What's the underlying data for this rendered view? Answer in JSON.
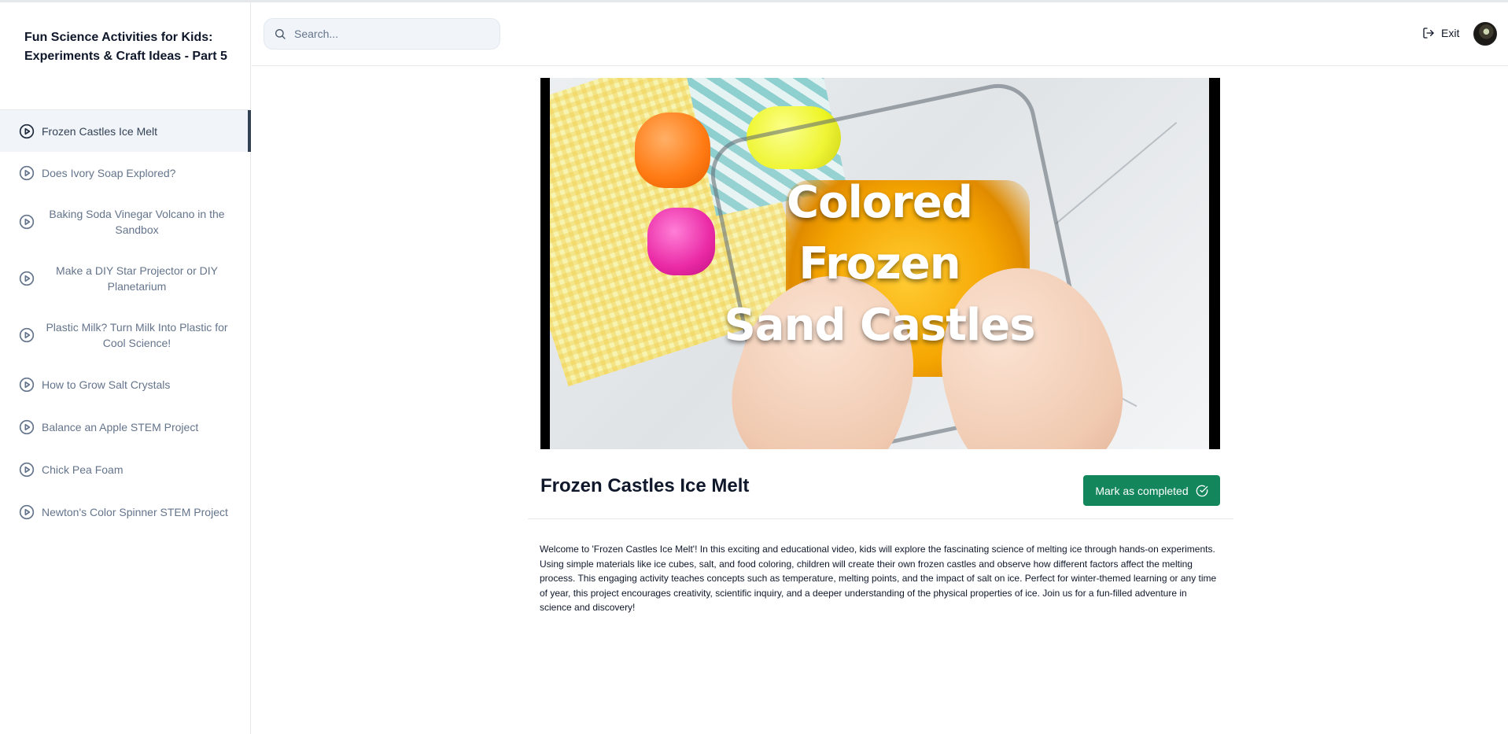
{
  "sidebar": {
    "course_title": "Fun Science Activities for Kids: Experiments & Craft Ideas - Part 5",
    "lessons": [
      {
        "label": "Frozen Castles Ice Melt",
        "active": true
      },
      {
        "label": "Does Ivory Soap Explored?"
      },
      {
        "label": "Baking Soda Vinegar Volcano in the Sandbox"
      },
      {
        "label": "Make a DIY Star Projector or DIY Planetarium"
      },
      {
        "label": "Plastic Milk? Turn Milk Into Plastic for Cool Science!"
      },
      {
        "label": "How to Grow Salt Crystals"
      },
      {
        "label": "Balance an Apple STEM Project"
      },
      {
        "label": "Chick Pea Foam"
      },
      {
        "label": "Newton's Color Spinner STEM Project"
      }
    ]
  },
  "header": {
    "search_placeholder": "Search...",
    "exit_label": "Exit"
  },
  "video": {
    "overlay_line1": "Colored",
    "overlay_line2": "Frozen",
    "overlay_line3": "Sand Castles"
  },
  "lesson": {
    "title": "Frozen Castles Ice Melt",
    "complete_button": "Mark as completed",
    "description": "Welcome to 'Frozen Castles Ice Melt'! In this exciting and educational video, kids will explore the fascinating science of melting ice through hands-on experiments. Using simple materials like ice cubes, salt, and food coloring, children will create their own frozen castles and observe how different factors affect the melting process. This engaging activity teaches concepts such as temperature, melting points, and the impact of salt on ice. Perfect for winter-themed learning or any time of year, this project encourages creativity, scientific inquiry, and a deeper understanding of the physical properties of ice. Join us for a fun-filled adventure in science and discovery!"
  },
  "colors": {
    "accent_green": "#13875b",
    "active_indicator": "#334155",
    "muted_text": "#64748b"
  },
  "icons": {
    "lesson": "play-circle-icon",
    "search": "search-icon",
    "exit": "log-out-icon",
    "complete": "check-circle-icon"
  }
}
